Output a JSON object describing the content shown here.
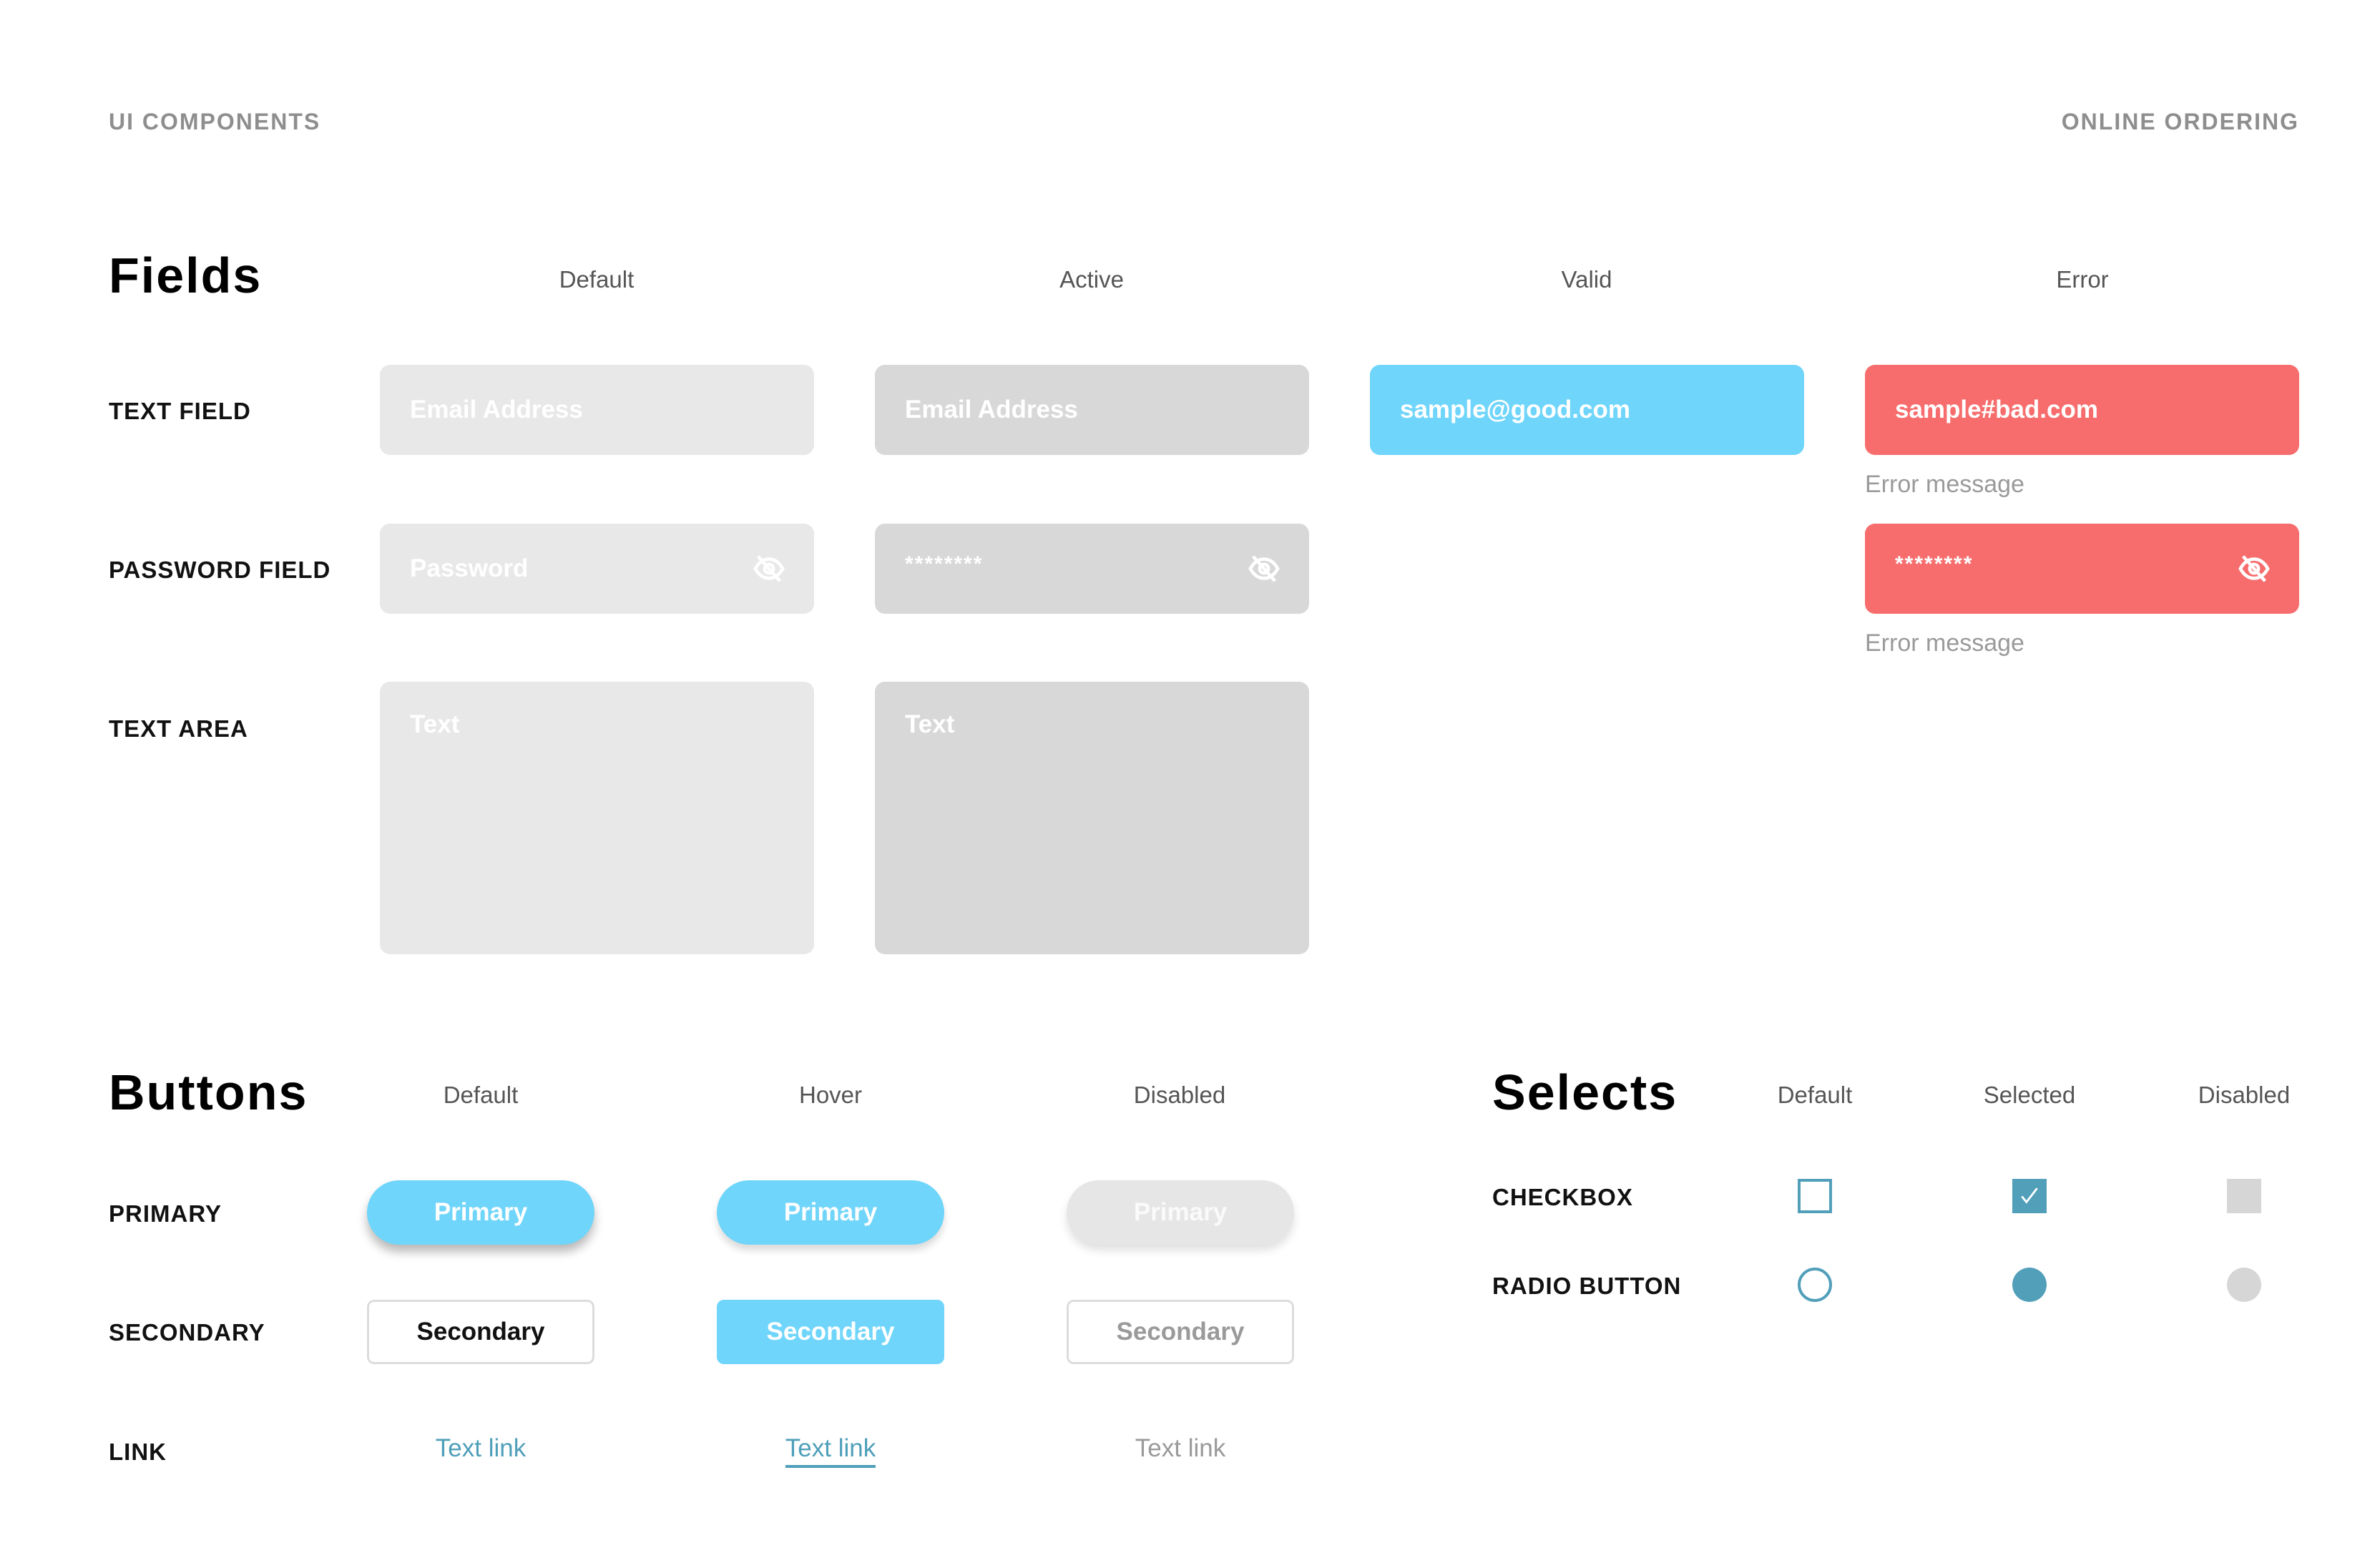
{
  "header": {
    "left": "UI COMPONENTS",
    "right": "ONLINE ORDERING"
  },
  "colors": {
    "valid": "#6fd5fa",
    "error": "#f76d6d",
    "accent": "#529fba",
    "field_default": "#e8e8e8",
    "field_active": "#d8d8d8"
  },
  "fields": {
    "title": "Fields",
    "columns": [
      "Default",
      "Active",
      "Valid",
      "Error"
    ],
    "rows": {
      "text_field": {
        "label": "TEXT FIELD",
        "default": "Email Address",
        "active": "Email Address",
        "valid": "sample@good.com",
        "error": "sample#bad.com",
        "error_message": "Error message"
      },
      "password_field": {
        "label": "PASSWORD FIELD",
        "default": "Password",
        "active": "********",
        "error": "********",
        "error_message": "Error message",
        "icon": "eye-off-icon"
      },
      "text_area": {
        "label": "TEXT AREA",
        "default": "Text",
        "active": "Text"
      }
    }
  },
  "buttons": {
    "title": "Buttons",
    "columns": [
      "Default",
      "Hover",
      "Disabled"
    ],
    "rows": {
      "primary": {
        "label": "PRIMARY",
        "text": "Primary"
      },
      "secondary": {
        "label": "SECONDARY",
        "text": "Secondary"
      },
      "link": {
        "label": "LINK",
        "text": "Text link"
      }
    }
  },
  "selects": {
    "title": "Selects",
    "columns": [
      "Default",
      "Selected",
      "Disabled"
    ],
    "rows": {
      "checkbox": {
        "label": "CHECKBOX",
        "states": [
          "unchecked",
          "checked",
          "disabled"
        ]
      },
      "radio": {
        "label": "RADIO BUTTON",
        "states": [
          "unselected",
          "selected",
          "disabled"
        ]
      }
    }
  }
}
